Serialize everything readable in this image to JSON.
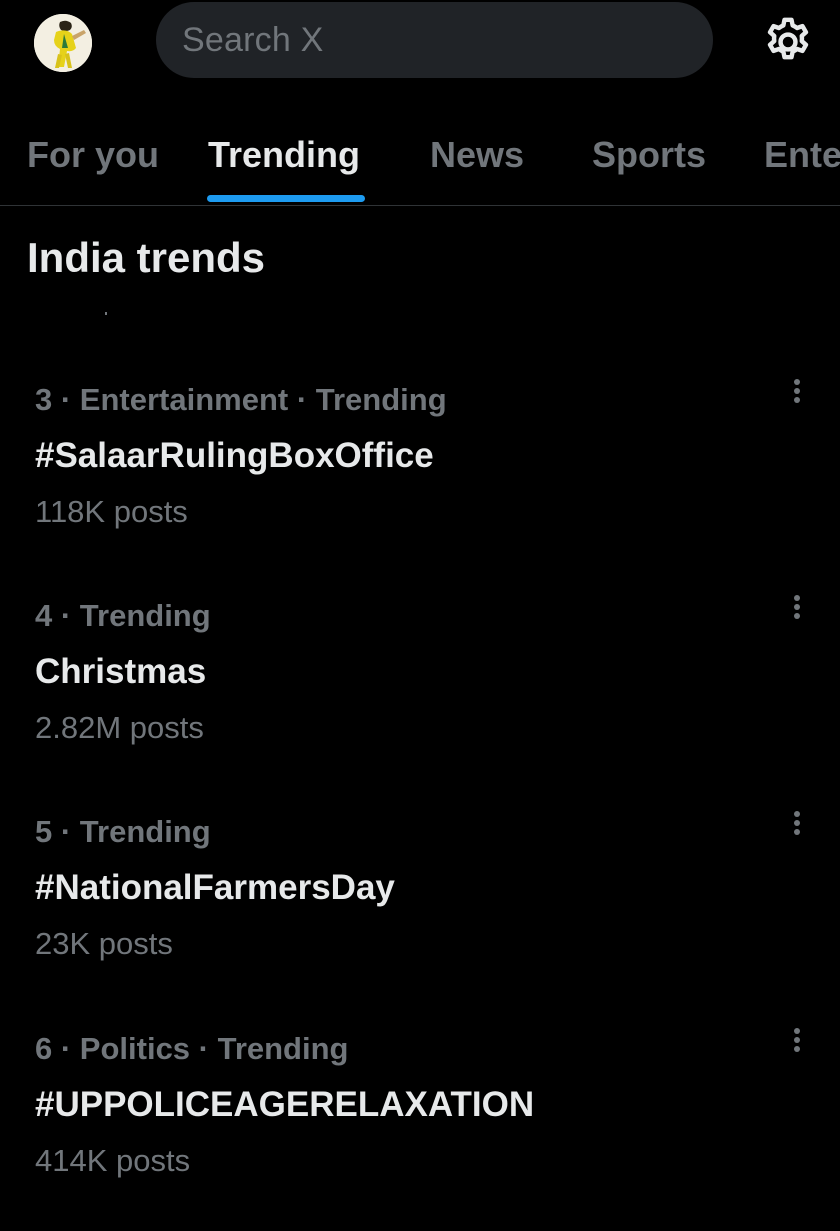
{
  "search": {
    "placeholder": "Search X"
  },
  "icons": {
    "avatar": "avatar-image",
    "settings": "gear-icon",
    "more": "more-vertical-icon"
  },
  "tabs": [
    {
      "label": "For you",
      "active": false
    },
    {
      "label": "Trending",
      "active": true
    },
    {
      "label": "News",
      "active": false
    },
    {
      "label": "Sports",
      "active": false
    },
    {
      "label": "Ente",
      "active": false
    }
  ],
  "section": {
    "title": "India trends"
  },
  "trends": [
    {
      "meta": "3 · Entertainment · Trending",
      "name": "#SalaarRulingBoxOffice",
      "count": "118K posts"
    },
    {
      "meta": "4 · Trending",
      "name": "Christmas",
      "count": "2.82M posts"
    },
    {
      "meta": "5 · Trending",
      "name": "#NationalFarmersDay",
      "count": "23K posts"
    },
    {
      "meta": "6 · Politics · Trending",
      "name": "#UPPOLICEAGERELAXATION",
      "count": "414K posts"
    }
  ],
  "colors": {
    "background": "#000000",
    "search_bg": "#202327",
    "accent": "#1d9bf0",
    "primary_text": "#e7e9ea",
    "secondary_text": "#71767b",
    "divider": "#2f3336"
  }
}
